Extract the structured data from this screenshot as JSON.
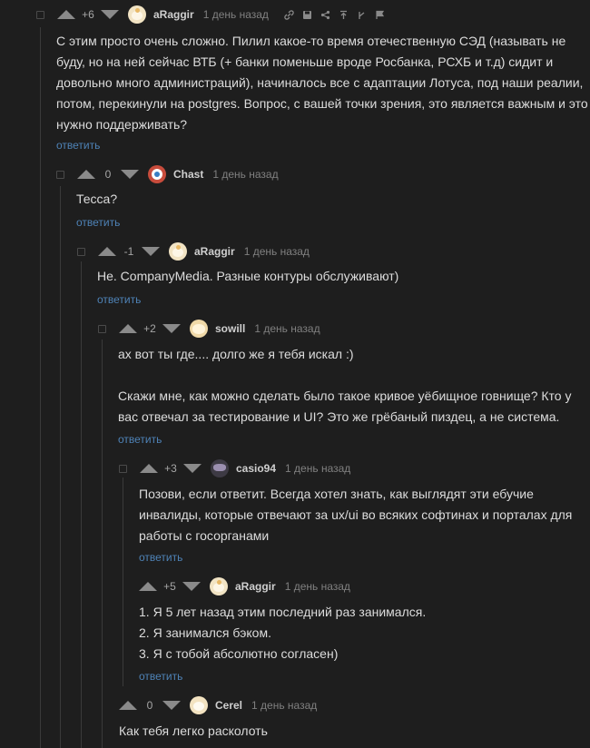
{
  "comments": [
    {
      "score": "+6",
      "user": "aRaggir",
      "time": "1 день назад",
      "text": [
        "С этим просто очень сложно. Пилил какое-то время отечественную СЭД (называть не",
        "буду, но на ней сейчас ВТБ (+ банки поменьше вроде Росбанка, РСХБ и т.д) сидит и",
        "довольно много администраций), начиналось все с адаптации Лотуса, под наши реалии,",
        "потом, перекинули на postgres. Вопрос, с вашей точки зрения, это является важным и это",
        "нужно поддерживать?"
      ],
      "reply": "ответить"
    },
    {
      "score": "0",
      "user": "Chast",
      "time": "1 день назад",
      "text": [
        "Тесса?"
      ],
      "reply": "ответить"
    },
    {
      "score": "-1",
      "user": "aRaggir",
      "time": "1 день назад",
      "text": [
        "Не. CompanyMedia. Разные контуры обслуживают)"
      ],
      "reply": "ответить"
    },
    {
      "score": "+2",
      "user": "sowill",
      "time": "1 день назад",
      "text": [
        "ах вот ты где.... долго же я тебя искал :)",
        "",
        "Скажи мне, как можно сделать было такое кривое уёбищное говнище? Кто у",
        "вас отвечал за тестирование и UI? Это же грёбаный пиздец, а не система."
      ],
      "reply": "ответить"
    },
    {
      "score": "+3",
      "user": "casio94",
      "time": "1 день назад",
      "text": [
        "Позови, если ответит. Всегда хотел знать, как выглядят эти ебучие",
        "инвалиды, которые отвечают за ux/ui во всяких софтинах и порталах для",
        "работы с госорганами"
      ],
      "reply": "ответить"
    },
    {
      "score": "+5",
      "user": "aRaggir",
      "time": "1 день назад",
      "text": [
        "1. Я 5 лет назад этим последний раз занимался.",
        "2. Я занимался бэком.",
        "3. Я с тобой абсолютно согласен)"
      ],
      "reply": "ответить"
    },
    {
      "score": "0",
      "user": "Cerel",
      "time": "1 день назад",
      "text": [
        "Как тебя легко расколоть"
      ],
      "reply": ""
    }
  ],
  "header_actions": [
    "link-icon",
    "save-icon",
    "share-icon",
    "go-to-parent-icon",
    "go-to-root-icon",
    "report-icon"
  ],
  "colors": {
    "background": "#1e1e1e",
    "text": "#dcdcdc",
    "link": "#4e82b6",
    "muted": "#808080"
  }
}
